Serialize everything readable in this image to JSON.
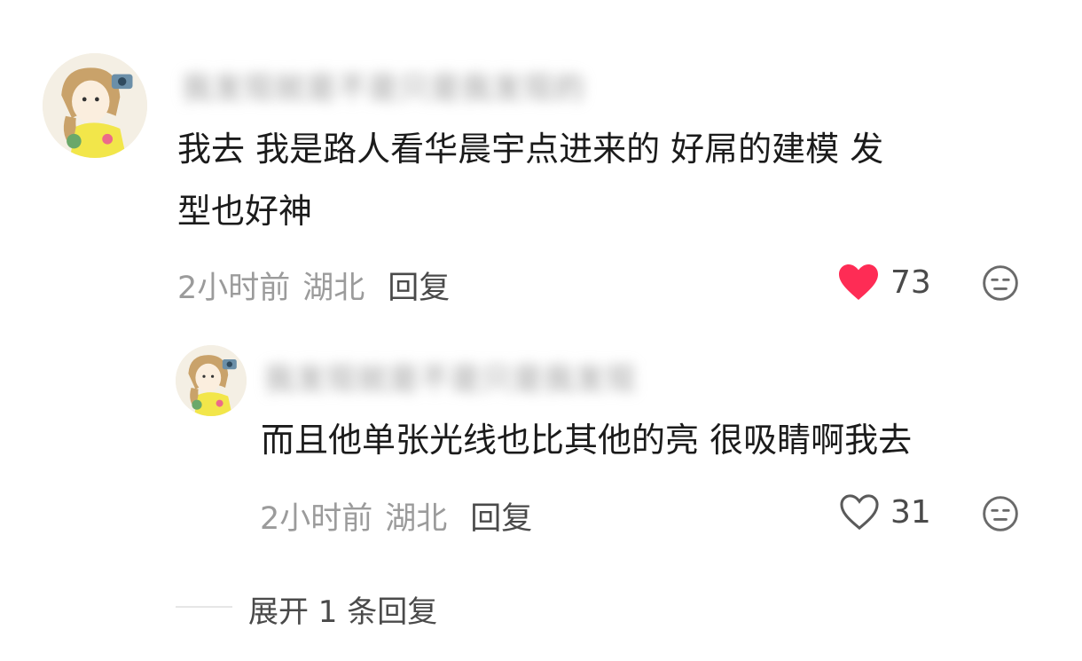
{
  "comments": [
    {
      "username": "我发现就是不是只是我发现的",
      "text_lines": [
        "我去 我是路人看华晨宇点进来的 好屌的建模 发",
        "型也好神"
      ],
      "time": "2小时前",
      "location": "湖北",
      "reply_label": "回复",
      "likes": "73",
      "liked": true
    },
    {
      "username": "我发现就是不是只是我发现",
      "text_lines": [
        "而且他单张光线也比其他的亮 很吸睛啊我去"
      ],
      "time": "2小时前",
      "location": "湖北",
      "reply_label": "回复",
      "likes": "31",
      "liked": false
    }
  ],
  "expand_label": "展开 1 条回复",
  "colors": {
    "like_active": "#fe2c55",
    "text_primary": "#1b1b1b",
    "text_meta": "#9b9b9b"
  }
}
